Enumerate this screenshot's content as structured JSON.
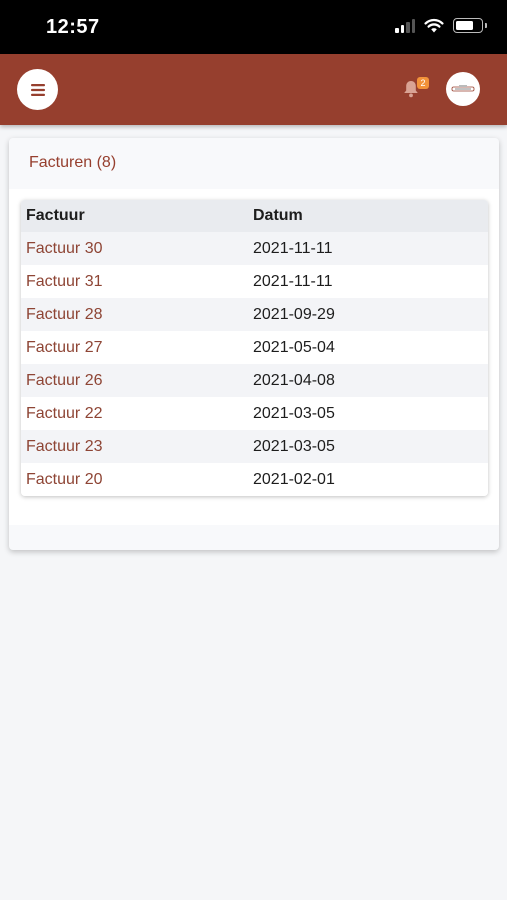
{
  "status_bar": {
    "time": "12:57"
  },
  "header": {
    "notification_count": "2",
    "brand_color": "#963f2e",
    "badge_color": "#f2923a"
  },
  "card": {
    "title": "Facturen (8)",
    "columns": [
      "Factuur",
      "Datum"
    ],
    "rows": [
      {
        "invoice": "Factuur 30",
        "date": "2021-11-11"
      },
      {
        "invoice": "Factuur 31",
        "date": "2021-11-11"
      },
      {
        "invoice": "Factuur 28",
        "date": "2021-09-29"
      },
      {
        "invoice": "Factuur 27",
        "date": "2021-05-04"
      },
      {
        "invoice": "Factuur 26",
        "date": "2021-04-08"
      },
      {
        "invoice": "Factuur 22",
        "date": "2021-03-05"
      },
      {
        "invoice": "Factuur 23",
        "date": "2021-03-05"
      },
      {
        "invoice": "Factuur 20",
        "date": "2021-02-01"
      }
    ]
  },
  "icons": {
    "menu": "hamburger-menu-icon",
    "notifications": "bell-icon",
    "profile": "avatar-logo-icon"
  }
}
